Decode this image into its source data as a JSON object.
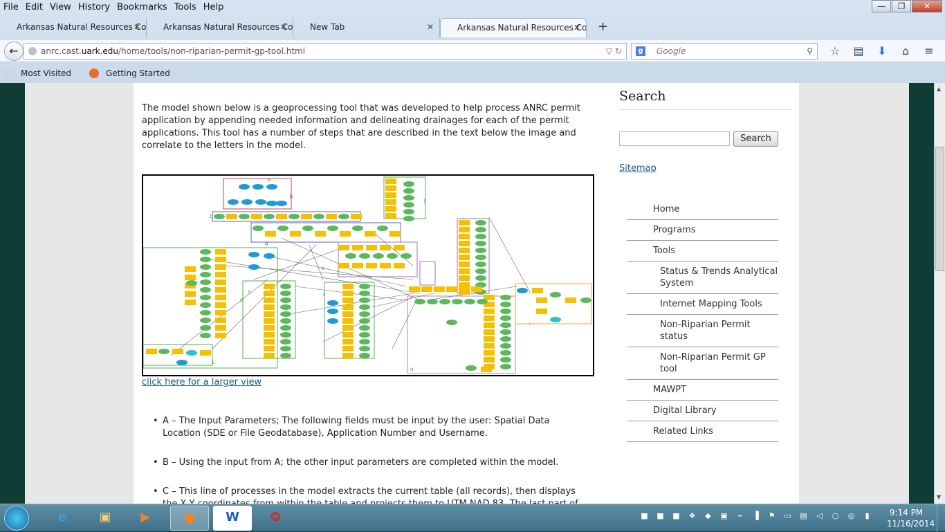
{
  "menu": [
    "File",
    "Edit",
    "View",
    "History",
    "Bookmarks",
    "Tools",
    "Help"
  ],
  "window_controls": {
    "minimize": "—",
    "maximize": "❐",
    "close": "✕"
  },
  "tabs": [
    {
      "label": "Arkansas Natural Resources Co...",
      "close": "✕"
    },
    {
      "label": "Arkansas Natural Resources Co...",
      "close": "✕"
    },
    {
      "label": "New Tab",
      "close": "✕"
    },
    {
      "label": "Arkansas Natural Resources Co...",
      "close": "✕"
    }
  ],
  "new_tab": "+",
  "url": {
    "host_prefix": "anrc.cast.",
    "host_domain": "uark.edu",
    "path": "/home/tools/non-riparian-permit-gp-tool.html"
  },
  "search_engine": {
    "icon": "g",
    "placeholder": "Google"
  },
  "bookmarks": [
    "Most Visited",
    "Getting Started"
  ],
  "main": {
    "intro": "The model shown below is a geoprocessing tool that was developed to help process ANRC permit application by appending needed information and delineating drainages for each of the permit applications. This tool has a number of steps that are described in the text below the image and correlate to the letters in the model.",
    "larger_view_link": "click here for a larger view",
    "bullets": [
      "A – The Input Parameters; The following fields must be input by the user: Spatial Data Location (SDE or File Geodatabase), Application Number and Username.",
      "B – Using the input from A; the other input parameters are completed within the model.",
      "C – This line of processes in the model extracts the current table (all records), then displays the X,Y coordinates from within the table and projects them to UTM NAD 83. The last part of this"
    ]
  },
  "sidebar": {
    "title": "Search",
    "search_button": "Search",
    "sitemap": "Sitemap",
    "nav": [
      {
        "label": "Home",
        "sub": false
      },
      {
        "label": "Programs",
        "sub": false
      },
      {
        "label": "Tools",
        "sub": false
      },
      {
        "label": "Status & Trends Analytical System",
        "sub": true
      },
      {
        "label": "Internet Mapping Tools",
        "sub": true
      },
      {
        "label": "Non-Riparian Permit status",
        "sub": true
      },
      {
        "label": "Non-Riparian Permit GP tool",
        "sub": true
      },
      {
        "label": "MAWPT",
        "sub": false
      },
      {
        "label": "Digital Library",
        "sub": false
      },
      {
        "label": "Related Links",
        "sub": false
      }
    ]
  },
  "model_labels": [
    "A",
    "B",
    "C",
    "D",
    "E",
    "F",
    "G",
    "H",
    "I",
    "J",
    "K",
    "L"
  ],
  "taskbar": {
    "time": "9:14 PM",
    "date": "11/16/2014"
  },
  "colors": {
    "page_bg": "#0e3d36",
    "link": "#1a5a8a",
    "model_yellow": "#f5c000",
    "model_green": "#5cb85c",
    "model_blue": "#1f9ad6"
  }
}
